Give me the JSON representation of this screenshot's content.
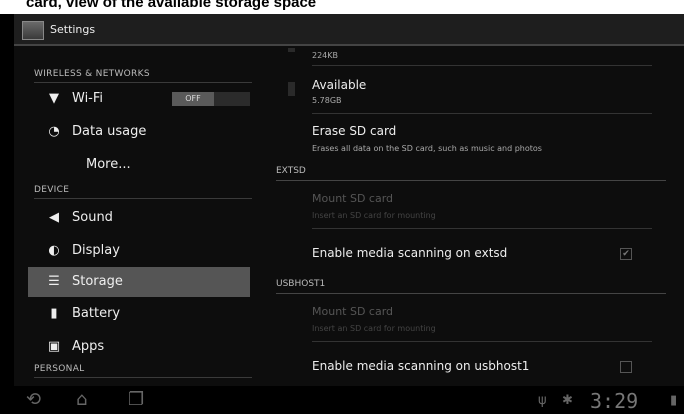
{
  "caption": "card, view of the available storage space",
  "app": {
    "title": "Settings"
  },
  "left": {
    "sections": {
      "wireless": "WIRELESS & NETWORKS",
      "device": "DEVICE",
      "personal": "PERSONAL"
    },
    "items": [
      {
        "label": "Wi-Fi",
        "icon": "wifi-icon",
        "toggle": "OFF"
      },
      {
        "label": "Data usage",
        "icon": "data-usage-icon"
      },
      {
        "label": "More..."
      },
      {
        "label": "Sound",
        "icon": "sound-icon"
      },
      {
        "label": "Display",
        "icon": "display-icon"
      },
      {
        "label": "Storage",
        "icon": "storage-icon",
        "selected": true
      },
      {
        "label": "Battery",
        "icon": "battery-icon"
      },
      {
        "label": "Apps",
        "icon": "apps-icon"
      }
    ]
  },
  "right": {
    "top_value": "224KB",
    "available": {
      "title": "Available",
      "value": "5.78GB"
    },
    "erase": {
      "title": "Erase SD card",
      "subtitle": "Erases all data on the SD card, such as music and photos"
    },
    "extsd": {
      "header": "EXTSD",
      "mount_title": "Mount SD card",
      "mount_sub": "Insert an SD card for mounting",
      "scan_label": "Enable media scanning on extsd",
      "scan_checked": true
    },
    "usbhost": {
      "header": "USBHOST1",
      "mount_title": "Mount SD card",
      "mount_sub": "Insert an SD card for mounting",
      "scan_label": "Enable media scanning on usbhost1",
      "scan_checked": false
    }
  },
  "system_bar": {
    "time": "3:29"
  }
}
